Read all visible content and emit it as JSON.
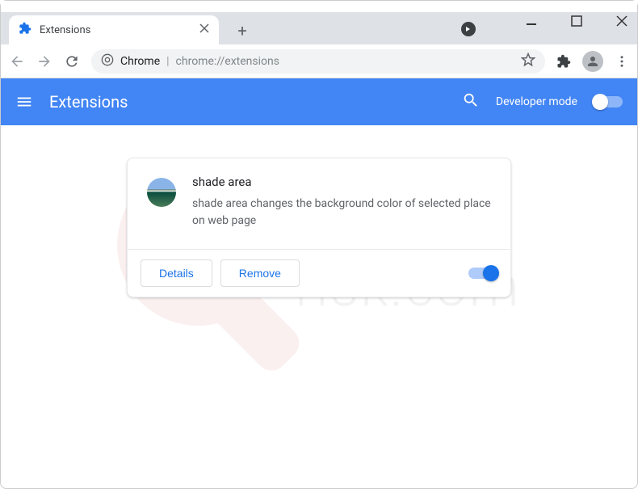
{
  "window": {
    "tab_title": "Extensions"
  },
  "omnibox": {
    "scheme_label": "Chrome",
    "url_path": "chrome://extensions"
  },
  "bluebar": {
    "title": "Extensions",
    "dev_mode_label": "Developer mode"
  },
  "extension": {
    "name": "shade area",
    "description": "shade area changes the background color of selected place on web page",
    "details_label": "Details",
    "remove_label": "Remove",
    "enabled": true
  }
}
